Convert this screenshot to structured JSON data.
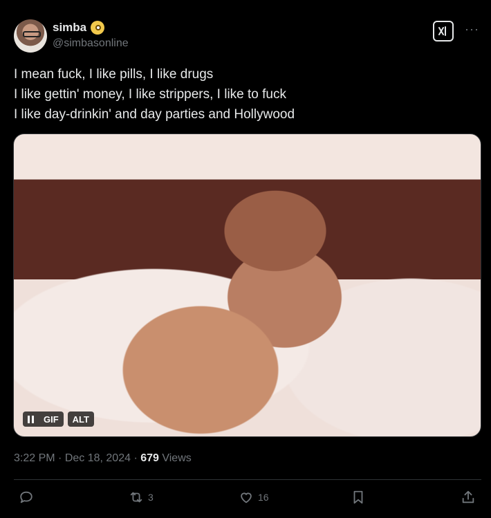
{
  "user": {
    "display_name": "simba",
    "handle": "@simbasonline",
    "verified_emoji_icon": "dizzy-face-emoji"
  },
  "tweet": {
    "lines": [
      "I mean fuck, I like pills, I like drugs",
      "I like gettin' money, I like strippers, I like to fuck",
      "I like day-drinkin' and day parties and Hollywood"
    ]
  },
  "media": {
    "gif_label": "GIF",
    "alt_label": "ALT"
  },
  "meta": {
    "time": "3:22 PM",
    "sep1": " · ",
    "date": "Dec 18, 2024",
    "sep2": " · ",
    "views_count": "679",
    "views_label": " Views"
  },
  "actions": {
    "reply_count": "",
    "retweet_count": "3",
    "like_count": "16"
  },
  "colors": {
    "background": "#000000",
    "text": "#e7e9ea",
    "muted": "#71767b",
    "border": "#2f3336"
  }
}
